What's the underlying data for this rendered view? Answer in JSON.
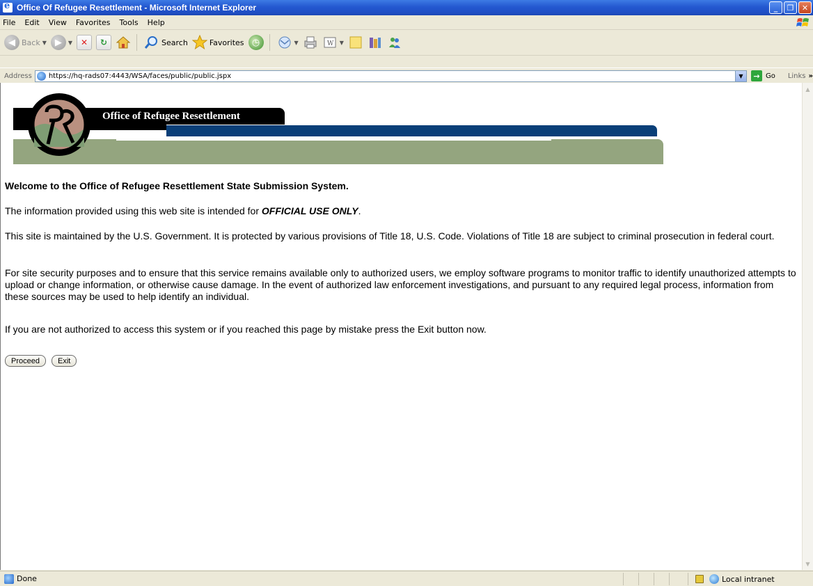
{
  "window": {
    "title": "Office Of Refugee Resettlement - Microsoft Internet Explorer",
    "controls": [
      "minimize",
      "restore",
      "close"
    ]
  },
  "menu": {
    "items": [
      "File",
      "Edit",
      "View",
      "Favorites",
      "Tools",
      "Help"
    ]
  },
  "toolbar": {
    "back_label": "Back",
    "search_label": "Search",
    "favorites_label": "Favorites"
  },
  "address": {
    "label": "Address",
    "url": "https://hq-rads07:4443/WSA/faces/public/public.jspx",
    "go_label": "Go",
    "links_label": "Links"
  },
  "banner": {
    "title": "Office of Refugee Resettlement"
  },
  "page": {
    "welcome": "Welcome to the Office of Refugee Resettlement State Submission System.",
    "p1_prefix": "The information provided using this web site is intended for ",
    "p1_emphasis": "OFFICIAL USE ONLY",
    "p1_suffix": ".",
    "p2": "This site is maintained by the U.S. Government. It is protected by various provisions of Title 18, U.S. Code. Violations of Title 18 are subject to criminal prosecution in federal court.",
    "p3": "For site security purposes and to ensure that this service remains available only to authorized users, we employ software programs to monitor traffic to identify unauthorized attempts to upload or change information, or otherwise cause damage. In the event of authorized law enforcement investigations, and pursuant to any required legal process, information from these sources may be used to help identify an individual.",
    "p4": "If you are not authorized to access this system or if you reached this page by mistake press the Exit button now.",
    "proceed_label": "Proceed",
    "exit_label": "Exit"
  },
  "status": {
    "text": "Done",
    "zone": "Local intranet"
  },
  "colors": {
    "banner_blue": "#0a3f78",
    "banner_green": "#94a57f",
    "titlebar_blue": "#2458d0"
  }
}
